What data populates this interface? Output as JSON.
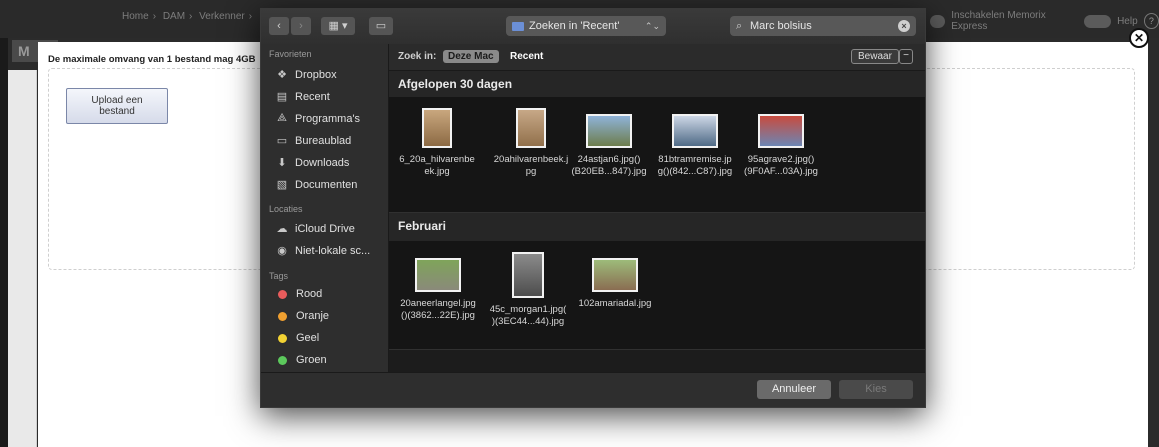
{
  "background": {
    "breadcrumb": [
      "Home",
      "DAM",
      "Verkenner"
    ],
    "express_toggle_label": "Inschakelen Memorix Express",
    "help_label": "Help",
    "app_logo": "M",
    "max_size_text": "De maximale omvang van 1 bestand mag 4GB",
    "upload_button_line1": "Upload een",
    "upload_button_line2": "bestand",
    "close_icon": "close-circle-icon"
  },
  "dialog": {
    "toolbar": {
      "view_icon": "grid-view-icon",
      "scope_select": "Zoeken in 'Recent'",
      "search_value": "Marc bolsius"
    },
    "sidebar": {
      "favorites_header": "Favorieten",
      "favorites": [
        {
          "label": "Dropbox",
          "icon": "dropbox-icon"
        },
        {
          "label": "Recent",
          "icon": "recent-icon"
        },
        {
          "label": "Programma's",
          "icon": "applications-icon"
        },
        {
          "label": "Bureaublad",
          "icon": "desktop-icon"
        },
        {
          "label": "Downloads",
          "icon": "downloads-icon"
        },
        {
          "label": "Documenten",
          "icon": "documents-icon"
        }
      ],
      "locations_header": "Locaties",
      "locations": [
        {
          "label": "iCloud Drive",
          "icon": "cloud-icon"
        },
        {
          "label": "Niet-lokale sc...",
          "icon": "disc-icon"
        }
      ],
      "tags_header": "Tags",
      "tags": [
        {
          "label": "Rood",
          "color": "#e85c5c"
        },
        {
          "label": "Oranje",
          "color": "#f0a030"
        },
        {
          "label": "Geel",
          "color": "#f2d233"
        },
        {
          "label": "Groen",
          "color": "#5cc95c"
        }
      ]
    },
    "scopebar": {
      "search_in_label": "Zoek in:",
      "this_mac": "Deze Mac",
      "recent": "Recent",
      "save": "Bewaar",
      "minus": "−"
    },
    "sections": [
      {
        "title": "Afgelopen 30 dagen",
        "files": [
          {
            "name": "6_20a_hilvarenbe\nek.jpg",
            "thumb": "portrait",
            "colors": [
              "#c9a77e",
              "#8c6a44"
            ]
          },
          {
            "name": "20ahilvarenbeek.j\npg",
            "thumb": "portrait",
            "colors": [
              "#c7a887",
              "#91704b"
            ]
          },
          {
            "name": "24astjan6.jpg()\n(B20EB...847).jpg",
            "thumb": "landscape",
            "colors": [
              "#8fb3d9",
              "#6d7d4d"
            ]
          },
          {
            "name": "81btramremise.jp\ng()(842...C87).jpg",
            "thumb": "landscape",
            "colors": [
              "#cdd7e6",
              "#4f6a86"
            ]
          },
          {
            "name": "95agrave2.jpg()\n(9F0AF...03A).jpg",
            "thumb": "landscape",
            "colors": [
              "#c84b3e",
              "#6c86b4"
            ]
          }
        ]
      },
      {
        "title": "Februari",
        "files": [
          {
            "name": "20aneerlangel.jpg\n()(3862...22E).jpg",
            "thumb": "landscape",
            "colors": [
              "#7fa45a",
              "#8a8a7a"
            ]
          },
          {
            "name": "45c_morgan1.jpg(\n)(3EC44...44).jpg",
            "thumb": "portrait",
            "colors": [
              "#8b8b8b",
              "#4d4d4d"
            ]
          },
          {
            "name": "102amariadal.jpg",
            "thumb": "landscape",
            "colors": [
              "#9dbb7a",
              "#8a6d52"
            ]
          }
        ]
      }
    ],
    "buttons": {
      "cancel": "Annuleer",
      "choose": "Kies"
    }
  }
}
